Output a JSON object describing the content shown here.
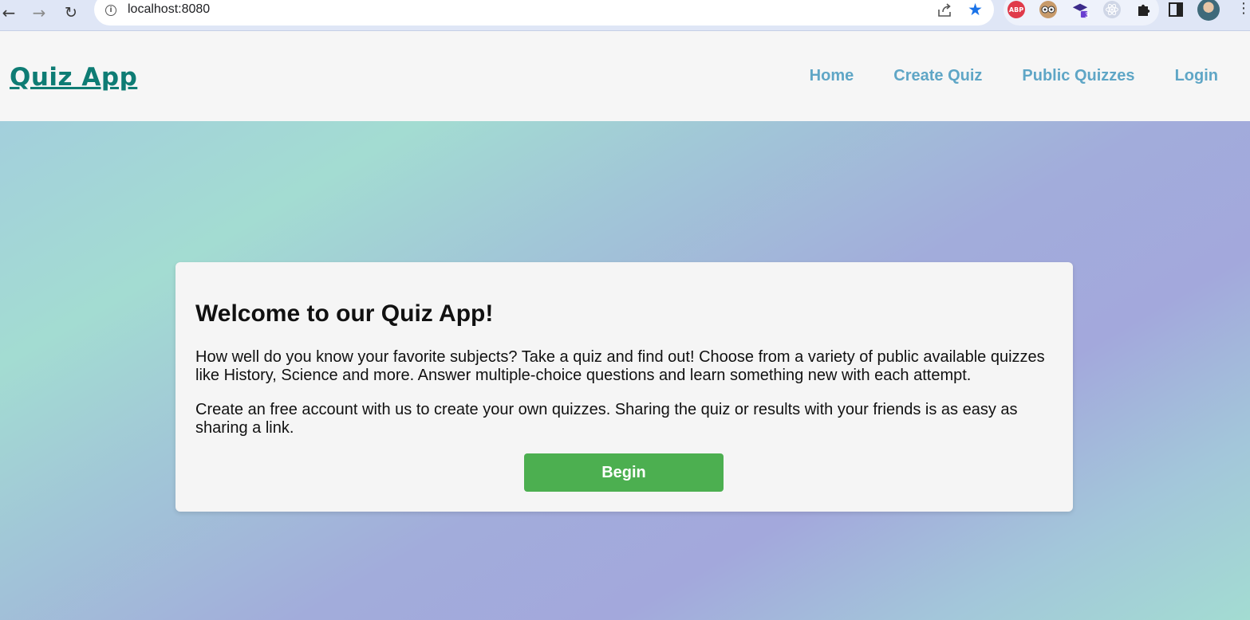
{
  "browser": {
    "url": "localhost:8080",
    "extensions": [
      {
        "name": "adblock-plus-icon",
        "label": "ABP",
        "color": "#e03a4a"
      },
      {
        "name": "owl-extension-icon",
        "label": "",
        "color": "#c79a6a"
      },
      {
        "name": "graduation-cap-extension-icon",
        "label": "3",
        "color": "#5b2ea6"
      },
      {
        "name": "react-devtools-icon",
        "label": "",
        "color": "#b9c2d6"
      }
    ]
  },
  "header": {
    "brand": "Quiz App",
    "nav": [
      "Home",
      "Create Quiz",
      "Public Quizzes",
      "Login"
    ]
  },
  "card": {
    "title": "Welcome to our Quiz App!",
    "paragraph1": "How well do you know your favorite subjects? Take a quiz and find out! Choose from a variety of public available quizzes like History, Science and more. Answer multiple-choice questions and learn something new with each attempt.",
    "paragraph2": "Create an free account with us to create your own quizzes. Sharing the quiz or results with your friends is as easy as sharing a link.",
    "button": "Begin"
  },
  "colors": {
    "brand": "#0e7c74",
    "nav_link": "#5fa6c6",
    "button": "#4caf50"
  }
}
